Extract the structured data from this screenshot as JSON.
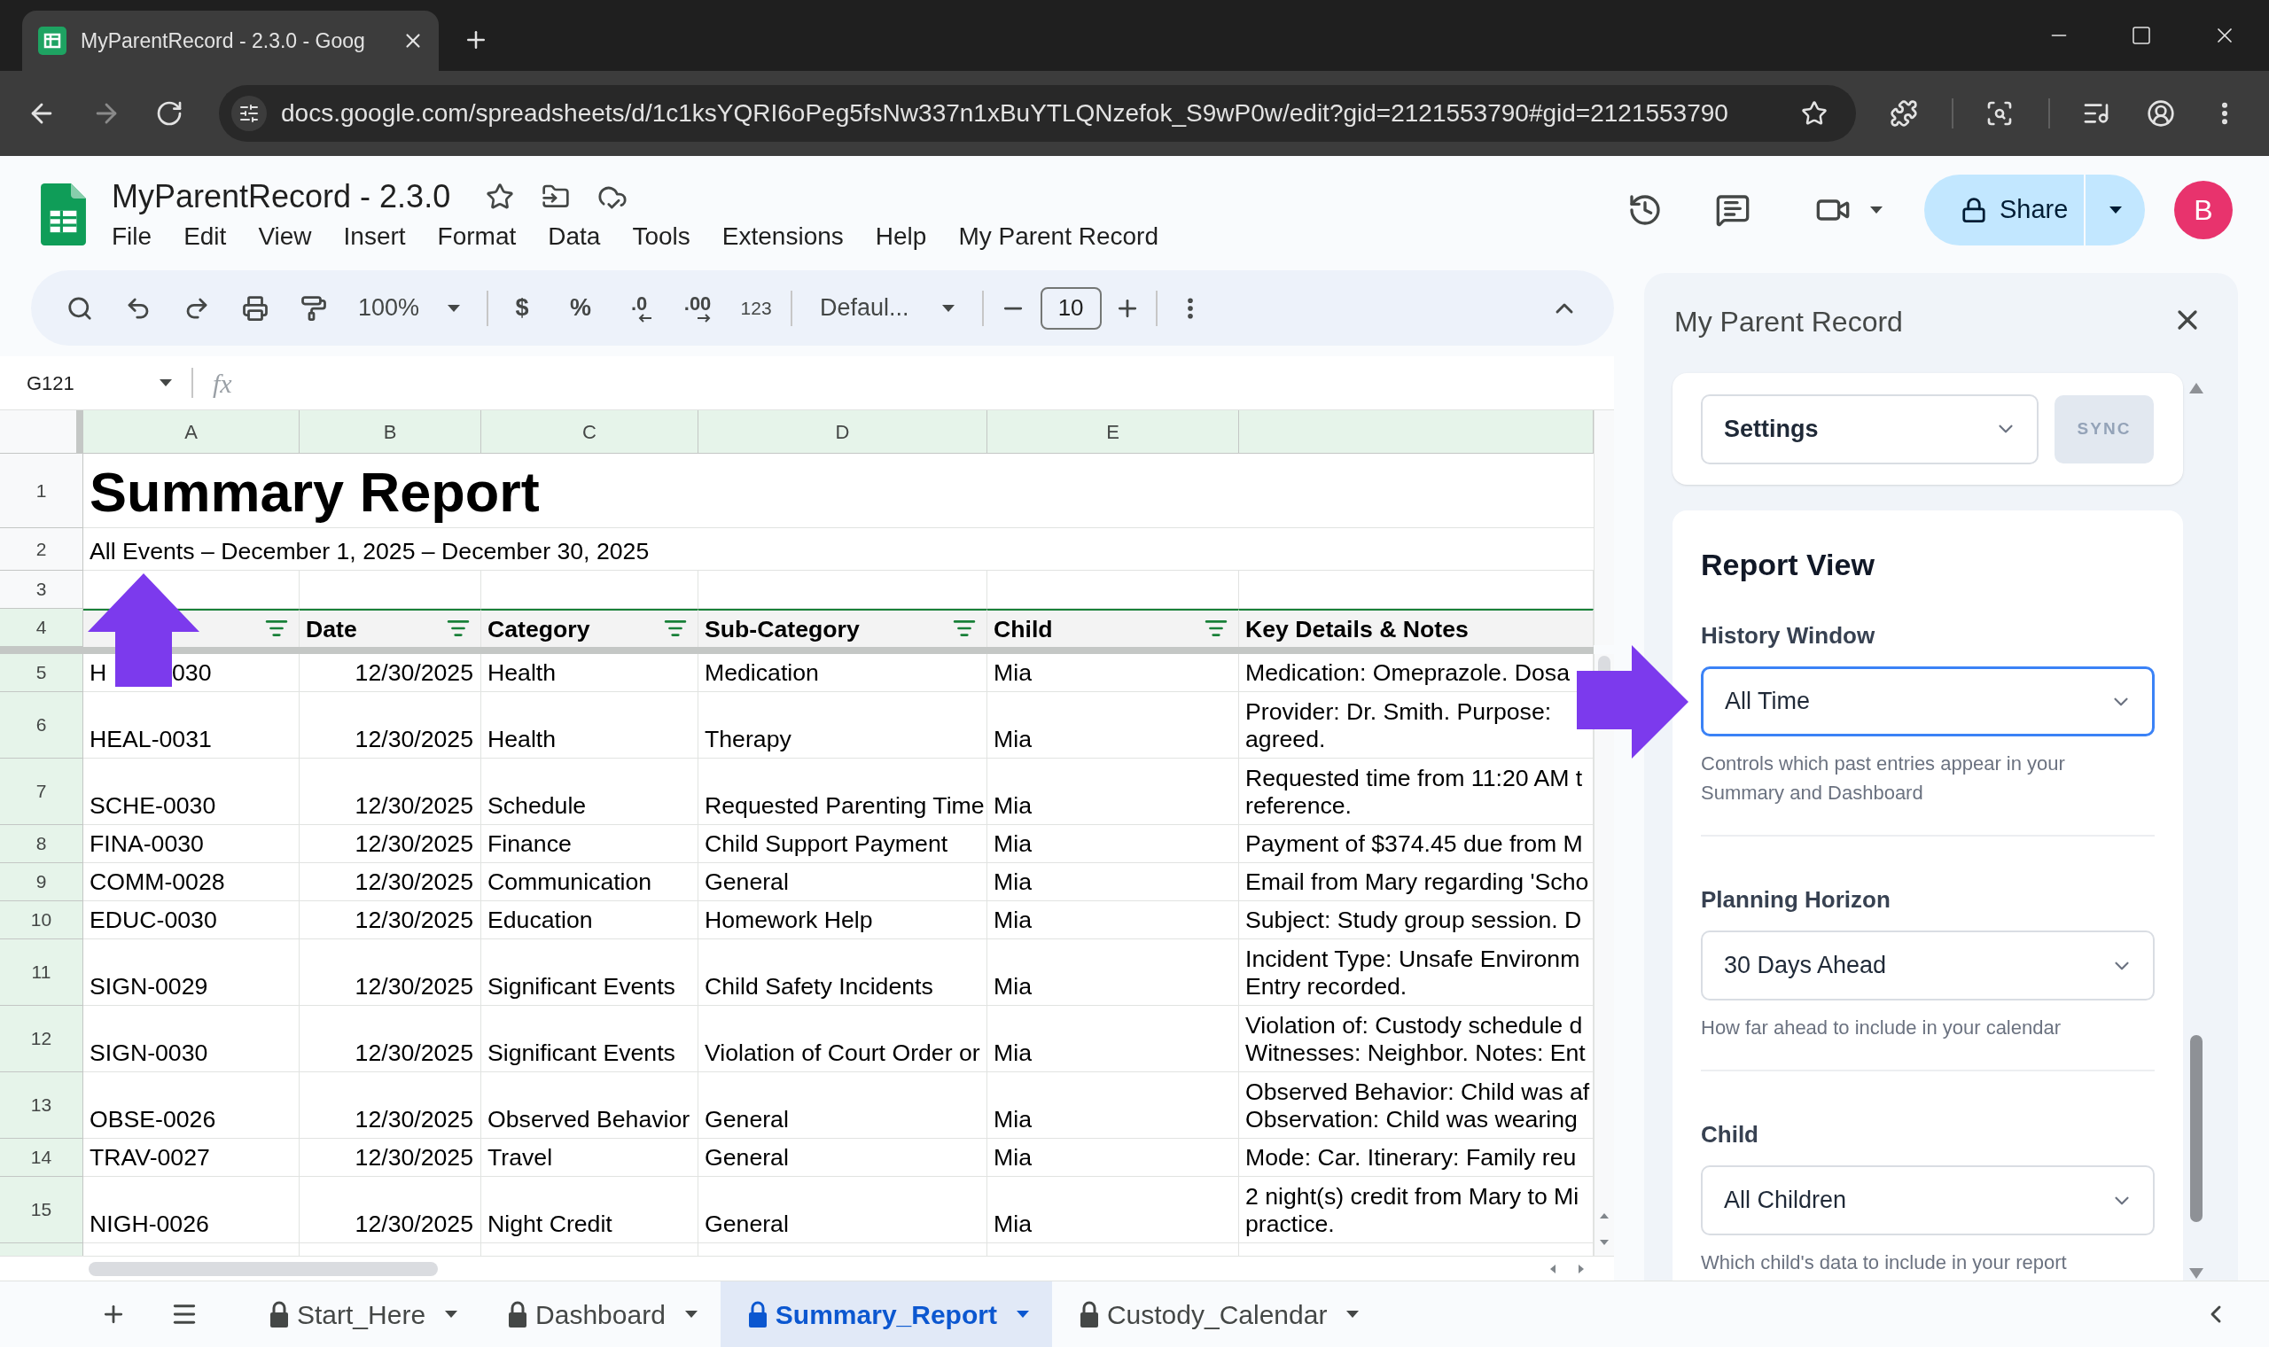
{
  "browser": {
    "tab_title": "MyParentRecord - 2.3.0 - Goog",
    "url": "docs.google.com/spreadsheets/d/1c1ksYQRI6oPeg5fsNw337n1xBuYTLQNzefok_S9wP0w/edit?gid=2121553790#gid=2121553790"
  },
  "document": {
    "title": "MyParentRecord - 2.3.0",
    "menu": [
      "File",
      "Edit",
      "View",
      "Insert",
      "Format",
      "Data",
      "Tools",
      "Extensions",
      "Help",
      "My Parent Record"
    ],
    "share_label": "Share",
    "avatar_initial": "B"
  },
  "toolbar": {
    "zoom": "100%",
    "currency": "$",
    "percent": "%",
    "decrease_decimal": ".0",
    "increase_decimal": ".00",
    "number_format": "123",
    "font": "Defaul...",
    "font_size": "10"
  },
  "formula_bar": {
    "cell_ref": "G121",
    "function_label": "fx"
  },
  "sheet": {
    "column_letters": [
      "A",
      "B",
      "C",
      "D",
      "E"
    ],
    "title_row": {
      "number": "1",
      "text": "Summary Report"
    },
    "subtitle_row": {
      "number": "2",
      "text": "All Events – December 1, 2025 – December 30, 2025"
    },
    "blank_row": {
      "number": "3"
    },
    "header_row": {
      "number": "4",
      "cells": [
        {
          "filter": true
        },
        {
          "label": "Date",
          "filter": true
        },
        {
          "label": "Category",
          "filter": true
        },
        {
          "label": "Sub-Category",
          "filter": true
        },
        {
          "label": "Child",
          "filter": true
        },
        {
          "label": "Key Details & Notes"
        }
      ]
    },
    "rows": [
      {
        "row_number": "5",
        "event_id_parts": [
          "H",
          "030"
        ],
        "date": "12/30/2025",
        "category": "Health",
        "sub_category": "Medication",
        "child": "Mia",
        "notes": [
          "Medication: Omeprazole. Dosa"
        ]
      },
      {
        "row_number": "6",
        "event_id_parts": [
          "HEAL-0031"
        ],
        "date": "12/30/2025",
        "category": "Health",
        "sub_category": "Therapy",
        "child": "Mia",
        "notes": [
          "Provider: Dr. Smith. Purpose:",
          "agreed."
        ]
      },
      {
        "row_number": "7",
        "event_id_parts": [
          "SCHE-0030"
        ],
        "date": "12/30/2025",
        "category": "Schedule",
        "sub_category": "Requested Parenting Time",
        "child": "Mia",
        "notes": [
          "Requested time from 11:20 AM t",
          "reference."
        ]
      },
      {
        "row_number": "8",
        "event_id_parts": [
          "FINA-0030"
        ],
        "date": "12/30/2025",
        "category": "Finance",
        "sub_category": "Child Support Payment",
        "child": "Mia",
        "notes": [
          "Payment of $374.45 due from M"
        ]
      },
      {
        "row_number": "9",
        "event_id_parts": [
          "COMM-0028"
        ],
        "date": "12/30/2025",
        "category": "Communication",
        "sub_category": "General",
        "child": "Mia",
        "notes": [
          "Email from Mary regarding 'Scho"
        ]
      },
      {
        "row_number": "10",
        "event_id_parts": [
          "EDUC-0030"
        ],
        "date": "12/30/2025",
        "category": "Education",
        "sub_category": "Homework Help",
        "child": "Mia",
        "notes": [
          "Subject: Study group session. D"
        ]
      },
      {
        "row_number": "11",
        "event_id_parts": [
          "SIGN-0029"
        ],
        "date": "12/30/2025",
        "category": "Significant Events",
        "sub_category": "Child Safety Incidents",
        "child": "Mia",
        "notes": [
          "Incident Type: Unsafe Environm",
          "Entry recorded."
        ]
      },
      {
        "row_number": "12",
        "event_id_parts": [
          "SIGN-0030"
        ],
        "date": "12/30/2025",
        "category": "Significant Events",
        "sub_category": "Violation of Court Order or",
        "child": "Mia",
        "notes": [
          "Violation of: Custody schedule d",
          "Witnesses: Neighbor. Notes: Ent"
        ]
      },
      {
        "row_number": "13",
        "event_id_parts": [
          "OBSE-0026"
        ],
        "date": "12/30/2025",
        "category": "Observed Behavior",
        "sub_category": "General",
        "child": "Mia",
        "notes": [
          "Observed Behavior: Child was af",
          "Observation: Child was wearing"
        ]
      },
      {
        "row_number": "14",
        "event_id_parts": [
          "TRAV-0027"
        ],
        "date": "12/30/2025",
        "category": "Travel",
        "sub_category": "General",
        "child": "Mia",
        "notes": [
          "Mode: Car. Itinerary: Family reu"
        ]
      },
      {
        "row_number": "15",
        "event_id_parts": [
          "NIGH-0026"
        ],
        "date": "12/30/2025",
        "category": "Night Credit",
        "sub_category": "General",
        "child": "Mia",
        "notes": [
          "2 night(s) credit from Mary to Mi",
          "practice."
        ]
      }
    ]
  },
  "sheet_tabs": [
    {
      "label": "Start_Here",
      "locked": true,
      "selected": false
    },
    {
      "label": "Dashboard",
      "locked": true,
      "selected": false
    },
    {
      "label": "Summary_Report",
      "locked": true,
      "selected": true
    },
    {
      "label": "Custody_Calendar",
      "locked": true,
      "selected": false
    }
  ],
  "sidebar": {
    "title": "My Parent Record",
    "menu_select": {
      "value": "Settings"
    },
    "sync_button": {
      "label": "SYNC",
      "disabled": true
    },
    "section_title": "Report View",
    "fields": [
      {
        "label": "History Window",
        "value": "All Time",
        "help": "Controls which past entries appear in your Summary and Dashboard",
        "focused": true
      },
      {
        "label": "Planning Horizon",
        "value": "30 Days Ahead",
        "help": "How far ahead to include in your calendar",
        "focused": false
      },
      {
        "label": "Child",
        "value": "All Children",
        "help": "Which child's data to include in your report",
        "focused": false
      }
    ]
  },
  "annotations": [
    {
      "kind": "up-arrow"
    },
    {
      "kind": "right-arrow"
    }
  ]
}
